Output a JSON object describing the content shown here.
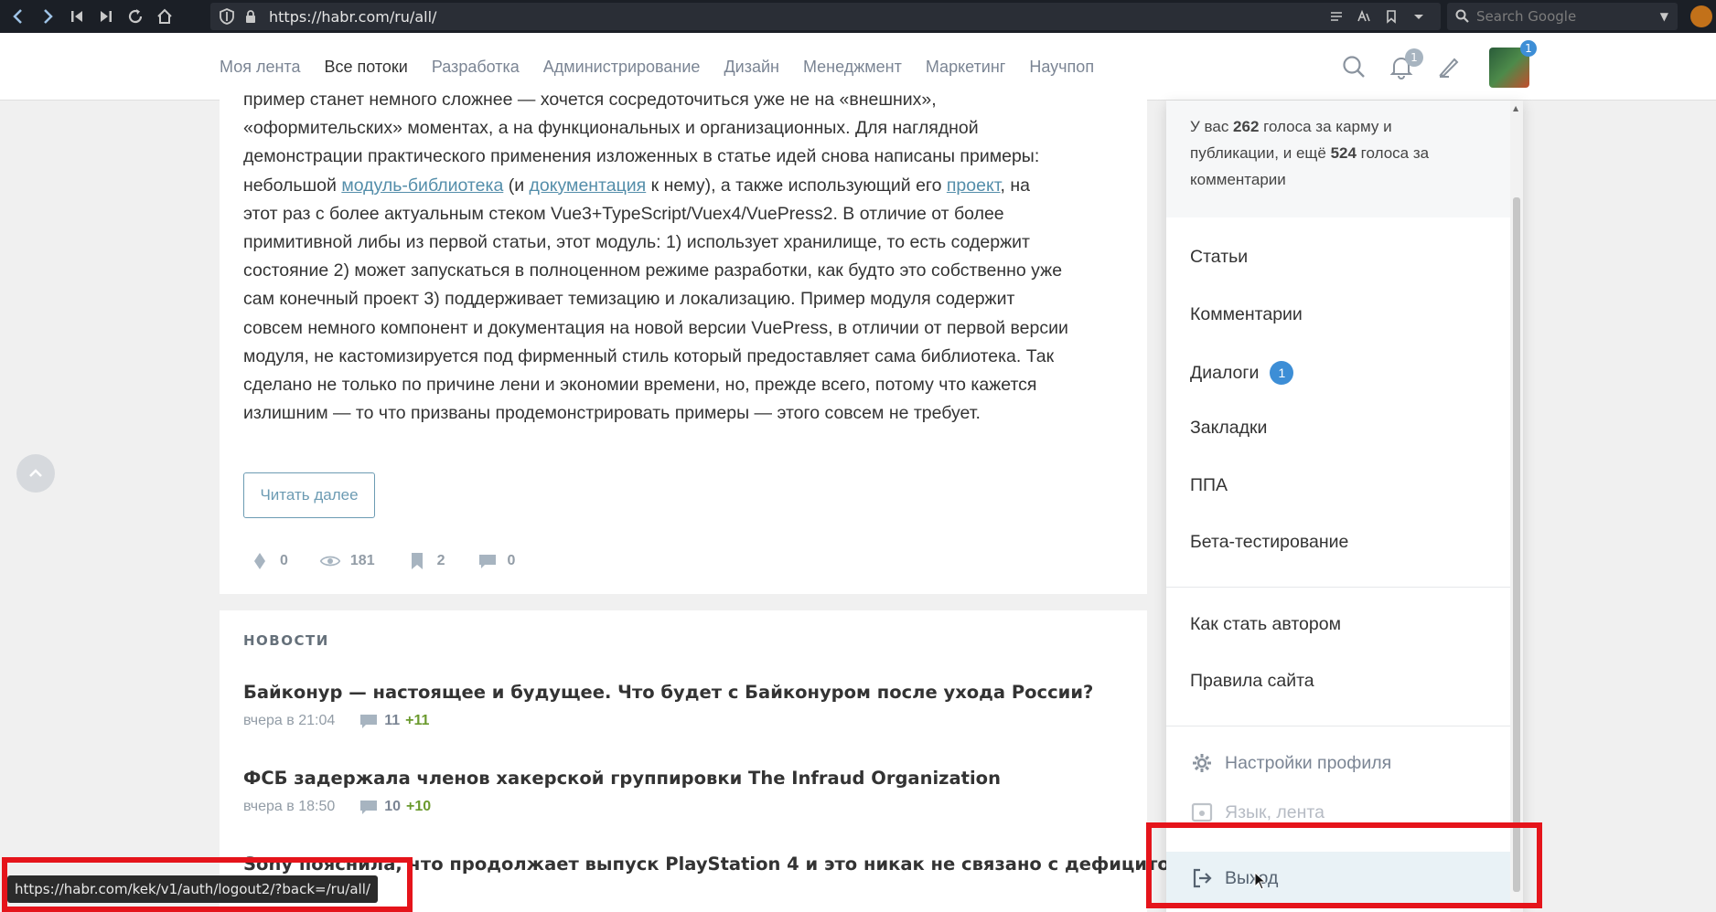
{
  "browser": {
    "url": "https://habr.com/ru/all/",
    "search_placeholder": "Search Google"
  },
  "header": {
    "nav": [
      "Моя лента",
      "Все потоки",
      "Разработка",
      "Администрирование",
      "Дизайн",
      "Менеджмент",
      "Маркетинг",
      "Научпоп"
    ],
    "active_nav": "Все потоки",
    "notifications_count": "1",
    "avatar_badge": "1"
  },
  "article": {
    "line1": "пример станет немного сложнее — хочется сосредоточиться уже не на «внешних»,",
    "line2": "«оформительских» моментах, а на функциональных и организационных. Для наглядной",
    "line3": "демонстрации практического применения изложенных в статье идей снова написаны примеры:",
    "l4_a": "небольшой ",
    "l4_link1": "модуль-библиотека",
    "l4_b": " (и ",
    "l4_link2": "документация",
    "l4_c": " к нему), а также использующий его ",
    "l4_link3": "проект",
    "l4_d": ", на",
    "line5": "этот раз с более актуальным стеком Vue3+TypeScript/Vuex4/VuePress2. В отличие от более",
    "line6": "примитивной либы из первой статьи, этот модуль: 1) использует хранилище, то есть содержит",
    "line7": "состояние 2) может запускаться в полноценном режиме разработки, как будто это собственно уже",
    "line8": "сам конечный проект 3) поддерживает темизацию и локализацию. Пример модуля содержит",
    "line9": "совсем немного компонент и документация на новой версии VuePress, в отличии от первой версии",
    "line10": "модуля, не кастомизируется под фирменный стиль который предоставляет сама библиотека. Так",
    "line11": "сделано не только по причине лени и экономии времени, но, прежде всего, потому что кажется",
    "line12": "излишним — то что призваны продемонстрировать примеры — этого совсем не требует.",
    "read_more": "Читать далее",
    "votes": "0",
    "views": "181",
    "bookmarks": "2",
    "comments": "0"
  },
  "news": {
    "title": "НОВОСТИ",
    "items": [
      {
        "headline": "Байконур — настоящее и будущее. Что будет с Байконуром после ухода России?",
        "time": "вчера в 21:04",
        "comments": "11",
        "new": "+11"
      },
      {
        "headline": "ФСБ задержала членов хакерской группировки The Infraud Organization",
        "time": "вчера в 18:50",
        "comments": "10",
        "new": "+10"
      },
      {
        "headline": "Sony пояснила, что продолжает выпуск PlayStation 4 и это никак не связано с дефицитом"
      }
    ]
  },
  "user_menu": {
    "karma_pre": "У вас ",
    "karma_votes": "262",
    "karma_mid": " голоса за карму и",
    "karma_line2_pre": "публикации, и ещё ",
    "comment_votes": "524",
    "karma_line2_post": " голоса за",
    "karma_line3": "комментарии",
    "items": [
      "Статьи",
      "Комментарии",
      "Диалоги",
      "Закладки",
      "ППА",
      "Бета-тестирование"
    ],
    "dialogs_badge": "1",
    "extra": [
      "Как стать автором",
      "Правила сайта"
    ],
    "settings": "Настройки профиля",
    "language": "Язык, лента",
    "logout": "Выход"
  },
  "status_bar": {
    "url": "https://habr.com/kek/v1/auth/logout2/?back=/ru/all/"
  },
  "colors": {
    "highlight": "#e5141b",
    "link": "#548eaa",
    "badge": "#3d8ed6"
  }
}
